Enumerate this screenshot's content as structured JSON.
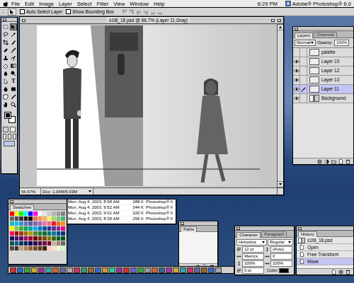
{
  "menu_bar": {
    "items": [
      "File",
      "Edit",
      "Image",
      "Layer",
      "Select",
      "Filter",
      "View",
      "Window",
      "Help"
    ],
    "clock": "6:29 PM",
    "app_name": "Adobe® Photoshop® 6.0"
  },
  "options_bar": {
    "checkboxes": [
      {
        "label": "Auto Select Layer",
        "checked": false
      },
      {
        "label": "Show Bounding Box",
        "checked": false
      }
    ],
    "align_buttons": [
      {
        "disabled": true
      },
      {
        "disabled": true
      },
      {
        "disabled": true
      },
      {
        "disabled": true
      },
      {
        "disabled": true
      },
      {
        "disabled": true
      }
    ]
  },
  "toolbox": {
    "tools": [
      {
        "selected": false
      },
      {
        "selected": true
      },
      {
        "selected": false
      },
      {
        "selected": false
      },
      {
        "selected": false
      },
      {
        "selected": false
      },
      {
        "selected": false
      },
      {
        "selected": false
      },
      {
        "selected": false
      },
      {
        "selected": false
      },
      {
        "selected": false
      },
      {
        "selected": false
      },
      {
        "selected": false
      },
      {
        "selected": false
      },
      {
        "selected": false
      },
      {
        "selected": false,
        "glyph": "T"
      },
      {
        "selected": false
      },
      {
        "selected": false
      },
      {
        "selected": false
      },
      {
        "selected": false
      },
      {
        "selected": false
      },
      {
        "selected": false
      }
    ],
    "foreground_color": "#000000",
    "background_color": "#ffffff"
  },
  "document": {
    "title": "s1t8_18.psd @ 66.7% (Layer 11,Gray)",
    "zoom": "66.67%",
    "doc_size": "Doc: 1.04M/5.03M"
  },
  "layers_palette": {
    "tabs": [
      {
        "label": "Layers",
        "selected": true
      },
      {
        "label": "Channels",
        "selected": false
      }
    ],
    "blend_mode": "Normal",
    "opacity_label": "Opacity:",
    "opacity": "100%",
    "layers": [
      {
        "name": "palette",
        "visible": false,
        "selected": false
      },
      {
        "name": "Layer 10",
        "visible": true,
        "selected": false
      },
      {
        "name": "Layer 12",
        "visible": true,
        "selected": false
      },
      {
        "name": "Layer 13",
        "visible": true,
        "selected": false
      },
      {
        "name": "Layer 11",
        "visible": true,
        "selected": true
      },
      {
        "name": "Background",
        "visible": true,
        "selected": false
      }
    ]
  },
  "file_list": {
    "rows": [
      {
        "date": "Mon, Aug 4, 2003, 8:58 AM",
        "size": "288 K",
        "kind": "Photoshop® fi"
      },
      {
        "date": "Mon, Aug 4, 2003, 9:52 AM",
        "size": "344 K",
        "kind": "Photoshop® fi"
      },
      {
        "date": "Mon, Aug 4, 2003, 9:01 AM",
        "size": "320 K",
        "kind": "Photoshop® fi"
      },
      {
        "date": "Mon, Aug 4, 2003, 8:39 AM",
        "size": "256 K",
        "kind": "Photoshop® fi"
      }
    ]
  },
  "swatches_palette": {
    "tabs": [
      {
        "label": "Swatches",
        "selected": true
      }
    ],
    "colors": [
      "#ff0000",
      "#ffff00",
      "#00ff00",
      "#00ffff",
      "#0000ff",
      "#ff00ff",
      "#ffffff",
      "#e6e6e6",
      "#cccccc",
      "#b3b3b3",
      "#999999",
      "#808080",
      "#666666",
      "#4d4d4d",
      "#333333",
      "#1a1a1a",
      "#000000",
      "#f26c4f",
      "#f68e55",
      "#fbaf5c",
      "#fff467",
      "#acd372",
      "#7cc576",
      "#3bb878",
      "#1abbb4",
      "#00bff3",
      "#438cca",
      "#5574b9",
      "#605ca8",
      "#855fa8",
      "#a763a8",
      "#f06ea9",
      "#f26d7d",
      "#ed1c24",
      "#f26522",
      "#f7941d",
      "#fff200",
      "#8dc73f",
      "#39b54a",
      "#00a651",
      "#00a99d",
      "#00aeef",
      "#0072bc",
      "#0054a6",
      "#2e3192",
      "#662d91",
      "#92278f",
      "#ec008c",
      "#ed145b",
      "#9e0b0f",
      "#a0410d",
      "#a36209",
      "#aba000",
      "#598527",
      "#1a7b30",
      "#007236",
      "#00746b",
      "#0076a3",
      "#004b80",
      "#003471",
      "#1b1464",
      "#440e62",
      "#630460",
      "#9e005d",
      "#9e0039",
      "#790000",
      "#7b2e00",
      "#7d4900",
      "#827b00",
      "#406618",
      "#005e20",
      "#005826",
      "#005952",
      "#005b7f",
      "#003663",
      "#002157",
      "#0d004c",
      "#32004b",
      "#4b0049",
      "#7b0046",
      "#7a0026",
      "#c7b299",
      "#998675",
      "#736357",
      "#534741",
      "#37302d",
      "#c69c6d",
      "#a67c52",
      "#8c6239",
      "#754c24",
      "#603913",
      "#42210b",
      "#ffcccc",
      "#ffe5cc",
      "#ffffcc",
      "#ccffcc"
    ]
  },
  "paths_palette": {
    "tabs": [
      {
        "label": "Paths",
        "selected": true
      }
    ]
  },
  "character_palette": {
    "tabs": [
      {
        "label": "Character",
        "selected": true
      },
      {
        "label": "Paragraph",
        "selected": false
      }
    ],
    "font": "Helvetica",
    "style": "Regular",
    "size": "12 pt",
    "leading": "(Auto)",
    "kerning": "Metrics",
    "tracking": "0",
    "vertical_scale": "100%",
    "horizontal_scale": "100%",
    "baseline_shift": "0 pt",
    "color_label": "Color:",
    "color": "#000000"
  },
  "history_palette": {
    "tabs": [
      {
        "label": "History",
        "selected": true
      }
    ],
    "snapshot": "s1t8_18.psd",
    "steps": [
      {
        "label": "Open",
        "selected": false
      },
      {
        "label": "Free Transform",
        "selected": false
      },
      {
        "label": "Move",
        "selected": true
      }
    ]
  }
}
